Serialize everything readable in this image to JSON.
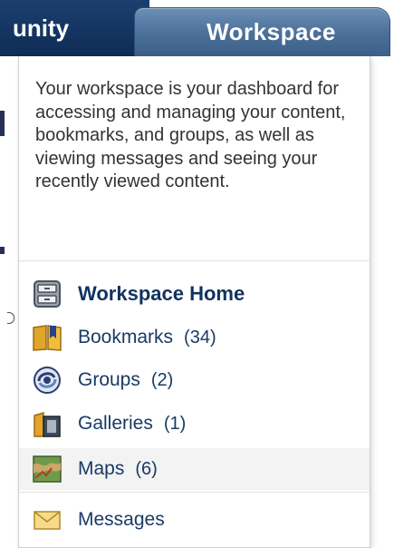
{
  "tabs": {
    "community_label": "unity",
    "workspace_label": "Workspace"
  },
  "dropdown": {
    "description": "Your workspace is your dashboard for accessing and managing your content, bookmarks, and groups, as well as viewing messages and seeing your recently viewed content.",
    "items": [
      {
        "label": "Workspace Home",
        "count": "",
        "icon": "workspace-home-icon"
      },
      {
        "label": "Bookmarks",
        "count": "(34)",
        "icon": "bookmarks-icon"
      },
      {
        "label": "Groups",
        "count": "(2)",
        "icon": "groups-icon"
      },
      {
        "label": "Galleries",
        "count": "(1)",
        "icon": "galleries-icon"
      },
      {
        "label": "Maps",
        "count": "(6)",
        "icon": "maps-icon"
      },
      {
        "label": "Messages",
        "count": "",
        "icon": "messages-icon"
      }
    ]
  },
  "colors": {
    "community_tab": "#0f2d56",
    "workspace_tab": "#4a6f98",
    "link_text": "#193a66",
    "hover_row": "#f3f3f3"
  }
}
